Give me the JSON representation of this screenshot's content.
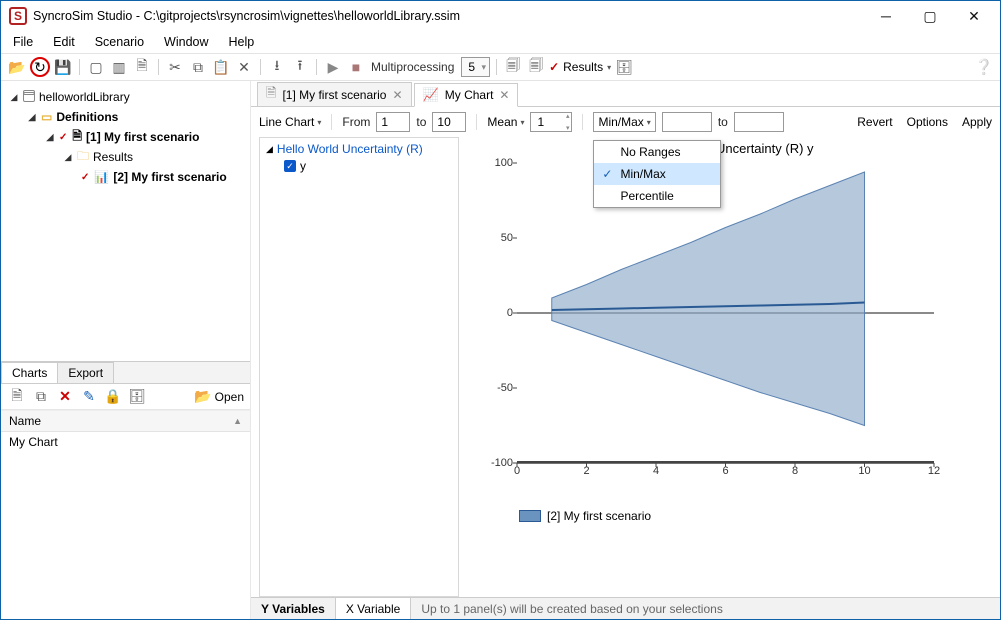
{
  "window": {
    "app_icon_letter": "S",
    "title": "SyncroSim Studio - C:\\gitprojects\\rsyncrosim\\vignettes\\helloworldLibrary.ssim"
  },
  "menubar": [
    "File",
    "Edit",
    "Scenario",
    "Window",
    "Help"
  ],
  "toolbar": {
    "multiprocessing_label": "Multiprocessing",
    "multiprocessing_value": "5",
    "results_label": "Results"
  },
  "tree": {
    "library": "helloworldLibrary",
    "definitions": "Definitions",
    "scenario1": "[1] My first scenario",
    "results_folder": "Results",
    "scenario2": "[2] My first scenario"
  },
  "charts_panel": {
    "tabs": [
      "Charts",
      "Export"
    ],
    "active_tab": 0,
    "open_label": "Open",
    "header": "Name",
    "items": [
      "My Chart"
    ]
  },
  "doc_tabs": [
    {
      "icon": "doc",
      "label": "[1] My first scenario"
    },
    {
      "icon": "chart",
      "label": "My Chart"
    }
  ],
  "active_doc_tab": 1,
  "chart_toolbar": {
    "chart_type": "Line Chart",
    "from_label": "From",
    "from_value": "1",
    "to_label": "to",
    "to_value": "10",
    "stat": "Mean",
    "stat_n": "1",
    "range_mode": "Min/Max",
    "revert": "Revert",
    "options": "Options",
    "apply": "Apply",
    "dropdown_items": [
      "No Ranges",
      "Min/Max",
      "Percentile"
    ],
    "dropdown_selected": 1
  },
  "yvars": {
    "group": "Hello World Uncertainty (R)",
    "var": "y"
  },
  "chart_title": "Hello World Uncertainty (R) y",
  "legend": "[2] My first scenario",
  "bottom_tabs": {
    "yvar": "Y Variables",
    "xvar": "X Variable",
    "hint": "Up to 1 panel(s) will be created based on your selections"
  },
  "chart_data": {
    "type": "area",
    "title": "Hello World Uncertainty (R) y",
    "xlabel": "",
    "ylabel": "",
    "x_ticks": [
      0,
      2,
      4,
      6,
      8,
      10,
      12
    ],
    "y_ticks": [
      -100,
      -50,
      0,
      50,
      100
    ],
    "xlim": [
      0,
      12
    ],
    "ylim": [
      -100,
      100
    ],
    "series": [
      {
        "name": "[2] My first scenario",
        "x": [
          1,
          2,
          3,
          4,
          5,
          6,
          7,
          8,
          9,
          10
        ],
        "mean": [
          2,
          2.5,
          3,
          3.5,
          4,
          4.5,
          5,
          5.5,
          6,
          7
        ],
        "min": [
          -5,
          -13,
          -21,
          -29,
          -37,
          -45,
          -53,
          -60,
          -67,
          -75
        ],
        "max": [
          10,
          19,
          29,
          38,
          47,
          57,
          66,
          76,
          85,
          94
        ]
      }
    ]
  }
}
